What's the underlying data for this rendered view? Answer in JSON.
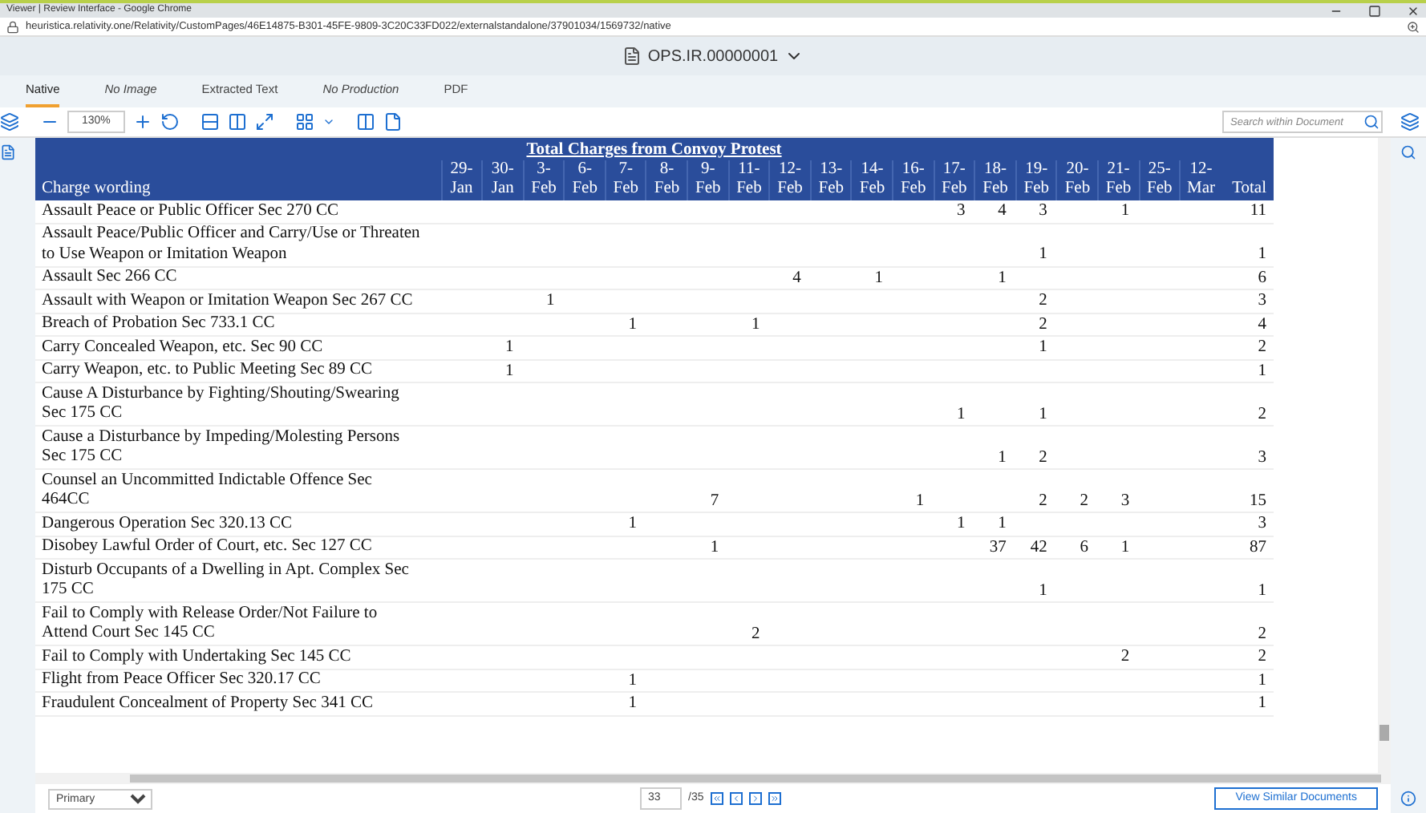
{
  "window": {
    "title": "Viewer | Review Interface - Google Chrome"
  },
  "address_bar": {
    "url": "heuristica.relativity.one/Relativity/CustomPages/46E14875-B301-45FE-9809-3C20C33FD022/externalstandalone/37901034/1569732/native"
  },
  "document": {
    "title": "OPS.IR.00000001"
  },
  "tabs": [
    {
      "label": "Native",
      "selected": true,
      "italic": false
    },
    {
      "label": "No Image",
      "selected": false,
      "italic": true
    },
    {
      "label": "Extracted Text",
      "selected": false,
      "italic": false
    },
    {
      "label": "No Production",
      "selected": false,
      "italic": true
    },
    {
      "label": "PDF",
      "selected": false,
      "italic": false
    }
  ],
  "toolbar": {
    "zoom": "130%",
    "search": {
      "placeholder": "Search within Document"
    }
  },
  "table": {
    "title": "Total Charges from Convoy Protest",
    "first_column": "Charge wording",
    "columns": [
      {
        "day": "29-",
        "month": "Jan"
      },
      {
        "day": "30-",
        "month": "Jan"
      },
      {
        "day": "3-",
        "month": "Feb"
      },
      {
        "day": "6-",
        "month": "Feb"
      },
      {
        "day": "7-",
        "month": "Feb"
      },
      {
        "day": "8-",
        "month": "Feb"
      },
      {
        "day": "9-",
        "month": "Feb"
      },
      {
        "day": "11-",
        "month": "Feb"
      },
      {
        "day": "12-",
        "month": "Feb"
      },
      {
        "day": "13-",
        "month": "Feb"
      },
      {
        "day": "14-",
        "month": "Feb"
      },
      {
        "day": "16-",
        "month": "Feb"
      },
      {
        "day": "17-",
        "month": "Feb"
      },
      {
        "day": "18-",
        "month": "Feb"
      },
      {
        "day": "19-",
        "month": "Feb"
      },
      {
        "day": "20-",
        "month": "Feb"
      },
      {
        "day": "21-",
        "month": "Feb"
      },
      {
        "day": "25-",
        "month": "Feb"
      },
      {
        "day": "12-",
        "month": "Mar"
      }
    ],
    "total_column": "Total",
    "rows": [
      {
        "charge": "Assault Peace or Public Officer Sec 270 CC",
        "cells": [
          null,
          null,
          null,
          null,
          null,
          null,
          null,
          null,
          null,
          null,
          null,
          null,
          "3",
          "4",
          "3",
          null,
          "1",
          null,
          null
        ],
        "total": "11"
      },
      {
        "charge": "Assault Peace/Public Officer and Carry/Use or Threaten to Use Weapon or Imitation Weapon",
        "cells": [
          null,
          null,
          null,
          null,
          null,
          null,
          null,
          null,
          null,
          null,
          null,
          null,
          null,
          null,
          "1",
          null,
          null,
          null,
          null
        ],
        "total": "1"
      },
      {
        "charge": "Assault Sec 266 CC",
        "cells": [
          null,
          null,
          null,
          null,
          null,
          null,
          null,
          null,
          "4",
          null,
          "1",
          null,
          null,
          "1",
          null,
          null,
          null,
          null,
          null
        ],
        "total": "6"
      },
      {
        "charge": "Assault with Weapon or Imitation Weapon Sec 267 CC",
        "cells": [
          null,
          null,
          "1",
          null,
          null,
          null,
          null,
          null,
          null,
          null,
          null,
          null,
          null,
          null,
          "2",
          null,
          null,
          null,
          null
        ],
        "total": "3"
      },
      {
        "charge": "Breach of Probation Sec 733.1 CC",
        "cells": [
          null,
          null,
          null,
          null,
          "1",
          null,
          null,
          "1",
          null,
          null,
          null,
          null,
          null,
          null,
          "2",
          null,
          null,
          null,
          null
        ],
        "total": "4"
      },
      {
        "charge": "Carry Concealed Weapon, etc. Sec 90 CC",
        "cells": [
          null,
          "1",
          null,
          null,
          null,
          null,
          null,
          null,
          null,
          null,
          null,
          null,
          null,
          null,
          "1",
          null,
          null,
          null,
          null
        ],
        "total": "2"
      },
      {
        "charge": "Carry Weapon, etc. to Public Meeting Sec 89 CC",
        "cells": [
          null,
          "1",
          null,
          null,
          null,
          null,
          null,
          null,
          null,
          null,
          null,
          null,
          null,
          null,
          null,
          null,
          null,
          null,
          null
        ],
        "total": "1"
      },
      {
        "charge": "Cause A Disturbance by Fighting/Shouting/Swearing Sec 175 CC",
        "cells": [
          null,
          null,
          null,
          null,
          null,
          null,
          null,
          null,
          null,
          null,
          null,
          null,
          "1",
          null,
          "1",
          null,
          null,
          null,
          null
        ],
        "total": "2"
      },
      {
        "charge": "Cause a Disturbance by Impeding/Molesting Persons Sec 175 CC",
        "cells": [
          null,
          null,
          null,
          null,
          null,
          null,
          null,
          null,
          null,
          null,
          null,
          null,
          null,
          "1",
          "2",
          null,
          null,
          null,
          null
        ],
        "total": "3"
      },
      {
        "charge": "Counsel an Uncommitted Indictable Offence Sec 464CC",
        "cells": [
          null,
          null,
          null,
          null,
          null,
          null,
          "7",
          null,
          null,
          null,
          null,
          "1",
          null,
          null,
          "2",
          "2",
          "3",
          null,
          null
        ],
        "total": "15"
      },
      {
        "charge": "Dangerous Operation Sec 320.13 CC",
        "cells": [
          null,
          null,
          null,
          null,
          "1",
          null,
          null,
          null,
          null,
          null,
          null,
          null,
          "1",
          "1",
          null,
          null,
          null,
          null,
          null
        ],
        "total": "3"
      },
      {
        "charge": "Disobey Lawful Order of Court, etc. Sec 127 CC",
        "cells": [
          null,
          null,
          null,
          null,
          null,
          null,
          "1",
          null,
          null,
          null,
          null,
          null,
          null,
          "37",
          "42",
          "6",
          "1",
          null,
          null
        ],
        "total": "87"
      },
      {
        "charge": "Disturb Occupants of a Dwelling in Apt. Complex Sec 175 CC",
        "cells": [
          null,
          null,
          null,
          null,
          null,
          null,
          null,
          null,
          null,
          null,
          null,
          null,
          null,
          null,
          "1",
          null,
          null,
          null,
          null
        ],
        "total": "1"
      },
      {
        "charge": "Fail to Comply with Release Order/Not Failure to Attend Court Sec 145 CC",
        "cells": [
          null,
          null,
          null,
          null,
          null,
          null,
          null,
          "2",
          null,
          null,
          null,
          null,
          null,
          null,
          null,
          null,
          null,
          null,
          null
        ],
        "total": "2"
      },
      {
        "charge": "Fail to Comply with Undertaking Sec 145 CC",
        "cells": [
          null,
          null,
          null,
          null,
          null,
          null,
          null,
          null,
          null,
          null,
          null,
          null,
          null,
          null,
          null,
          null,
          "2",
          null,
          null
        ],
        "total": "2"
      },
      {
        "charge": "Flight from Peace Officer Sec 320.17 CC",
        "cells": [
          null,
          null,
          null,
          null,
          "1",
          null,
          null,
          null,
          null,
          null,
          null,
          null,
          null,
          null,
          null,
          null,
          null,
          null,
          null
        ],
        "total": "1"
      },
      {
        "charge": "Fraudulent Concealment of Property Sec 341 CC",
        "cells": [
          null,
          null,
          null,
          null,
          "1",
          null,
          null,
          null,
          null,
          null,
          null,
          null,
          null,
          null,
          null,
          null,
          null,
          null,
          null
        ],
        "total": "1"
      }
    ]
  },
  "footer": {
    "layout": "Primary",
    "page": "33",
    "page_count": "/35",
    "button": "View Similar Documents"
  }
}
